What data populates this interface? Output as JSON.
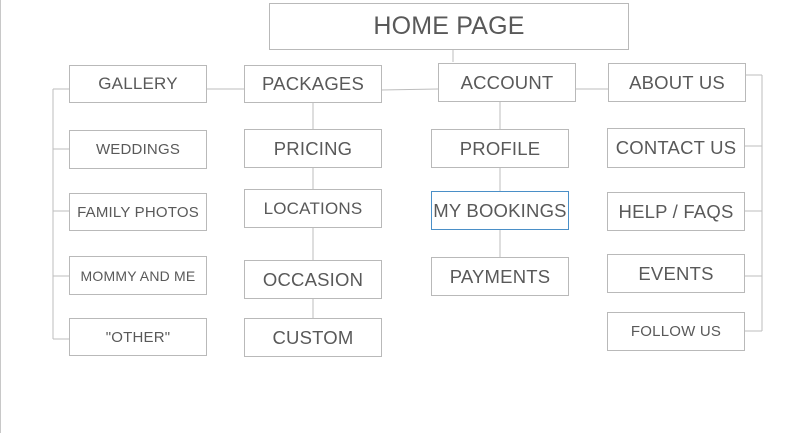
{
  "diagram": {
    "root": {
      "label": "HOME PAGE"
    },
    "sections": [
      {
        "label": "GALLERY",
        "children": [
          "WEDDINGS",
          "FAMILY PHOTOS",
          "MOMMY AND ME",
          "\"OTHER\""
        ]
      },
      {
        "label": "PACKAGES",
        "children": [
          "PRICING",
          "LOCATIONS",
          "OCCASION",
          "CUSTOM"
        ]
      },
      {
        "label": "ACCOUNT",
        "children": [
          "PROFILE",
          "MY BOOKINGS",
          "PAYMENTS"
        ]
      },
      {
        "label": "ABOUT US",
        "children": [
          "CONTACT US",
          "HELP / FAQS",
          "EVENTS",
          "FOLLOW US"
        ]
      }
    ],
    "colors": {
      "border": "#b9b9b9",
      "selected_border": "#4a8fc7",
      "text": "#595959",
      "connector": "#bdbdbd"
    }
  }
}
